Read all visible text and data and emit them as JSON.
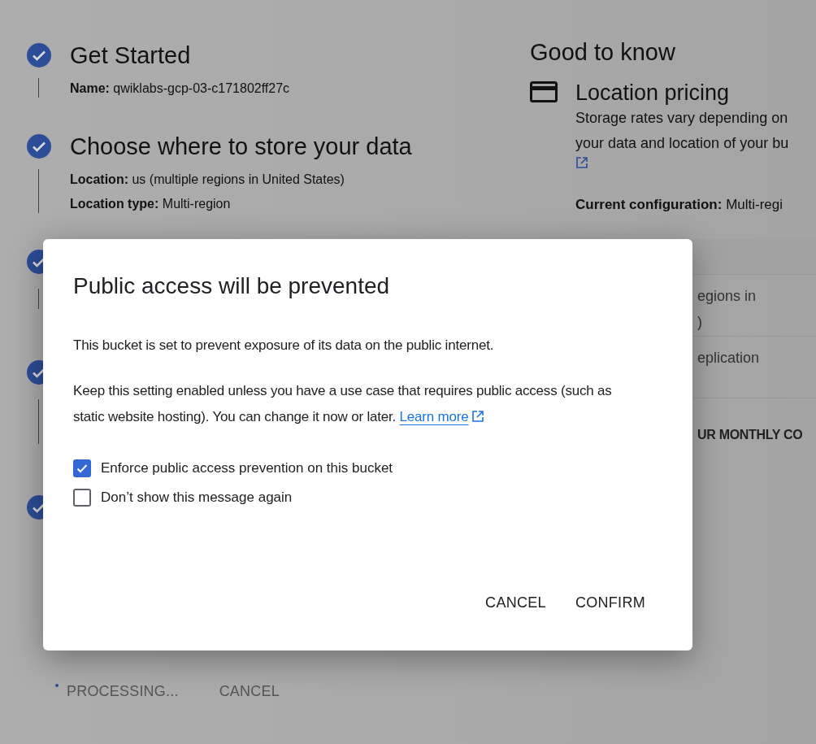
{
  "steps": [
    {
      "title": "Get Started",
      "completed": true,
      "details": [
        {
          "label": "Name:",
          "value": "qwiklabs-gcp-03-c171802ff27c"
        }
      ]
    },
    {
      "title": "Choose where to store your data",
      "completed": true,
      "details": [
        {
          "label": "Location:",
          "value": "us (multiple regions in United States)"
        },
        {
          "label": "Location type:",
          "value": "Multi-region"
        }
      ]
    },
    {
      "completed": true
    },
    {
      "completed": true
    },
    {
      "completed": true
    }
  ],
  "footer_buttons": [
    {
      "label": "PROCESSING...",
      "kind": "processing"
    },
    {
      "label": "CANCEL",
      "kind": "text"
    }
  ],
  "good_to_know": {
    "title": "Good to know",
    "section_title": "Location pricing",
    "lines": [
      "Storage rates vary depending on",
      "your data and location of your bu"
    ],
    "current_configuration": {
      "label": "Current configuration:",
      "value": "Multi-regi"
    },
    "table_rows": [
      [
        "egions in",
        ")"
      ],
      [
        "eplication"
      ]
    ],
    "total_label": "UR MONTHLY CO"
  },
  "dialog": {
    "title": "Public access will be prevented",
    "paragraphs": [
      "This bucket is set to prevent exposure of its data on the public internet.",
      "Keep this setting enabled unless you have a use case that requires public access (such as static website hosting). You can change it now or later."
    ],
    "link": "Learn more",
    "checkboxes": [
      {
        "label": "Enforce public access prevention on this bucket",
        "checked": true
      },
      {
        "label": "Don’t show this message again",
        "checked": false
      }
    ],
    "buttons": [
      "CANCEL",
      "CONFIRM"
    ]
  }
}
